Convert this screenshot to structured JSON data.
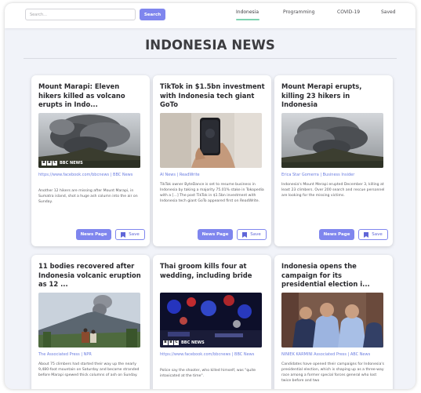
{
  "search": {
    "placeholder": "Search...",
    "button_label": "Search"
  },
  "nav": [
    {
      "label": "Indonesia",
      "active": true
    },
    {
      "label": "Programming",
      "active": false
    },
    {
      "label": "COVID-19",
      "active": false
    },
    {
      "label": "Saved",
      "active": false
    }
  ],
  "page_title": "INDONESIA NEWS",
  "cards": [
    {
      "title": "Mount Marapi: Eleven hikers killed as volcano erupts in Indo...",
      "source": "https://www.facebook.com/bbcnews | BBC News",
      "description": "Another 12 hikers are missing after Mount Marapi, in Sumatra island, shot a huge ash column into the air on Sunday.",
      "image": "volcano-ash-plume-photo",
      "image_logo": "BBC NEWS",
      "news_button": "News Page",
      "save_button": "Save"
    },
    {
      "title": "TikTok in $1.5bn investment with Indonesia tech giant GoTo",
      "source": "AI News | ReadWrite",
      "description": "TikTok owner ByteDance is set to resume business in Indonesia by taking a majority 75.01% stake in Tokopedia with a […] The post TikTok in $1.5bn investment with Indonesia tech giant GoTo appeared first on ReadWrite.",
      "image": "hand-holding-phone-photo",
      "news_button": "News Page",
      "save_button": "Save"
    },
    {
      "title": "Mount Merapi erupts, killing 23 hikers in Indonesia",
      "source": "Erica Star Gomerra | Business Insider",
      "description": "Indonesia's Mount Merapi erupted December 3, killing at least 23 climbers. Over 200 search and rescue personnel are looking for the missing victims.",
      "image": "volcano-ash-plume-photo",
      "news_button": "News Page",
      "save_button": "Save"
    },
    {
      "title": "11 bodies recovered after Indonesia volcanic eruption as 12 ...",
      "source": "The Associated Press | NPR",
      "description": "About 75 climbers had started their way up the nearly 9,480-foot mountain on Saturday and became stranded before Marapi spewed thick columns of ash on Sunday.",
      "image": "rescue-team-at-volcano-photo"
    },
    {
      "title": "Thai groom kills four at wedding, including bride",
      "source": "https://www.facebook.com/bbcnews | BBC News",
      "description": "Police say the shooter, who killed himself, was \"quite intoxicated at the time\".",
      "image": "police-lights-night-photo",
      "image_logo": "BBC NEWS"
    },
    {
      "title": "Indonesia opens the campaign for its presidential election i...",
      "source": "NINIEK KARMINI Associated Press | ABC News",
      "description": "Candidates have opened their campaigns for Indonesia's presidential election, which is shaping up as a three-way race among a former special forces general who lost twice before and two",
      "image": "candidates-at-campaign-photo"
    }
  ],
  "colors": {
    "accent": "#7f86ee",
    "nav_underline": "#7ed3b0",
    "source_link": "#6b7de0"
  }
}
